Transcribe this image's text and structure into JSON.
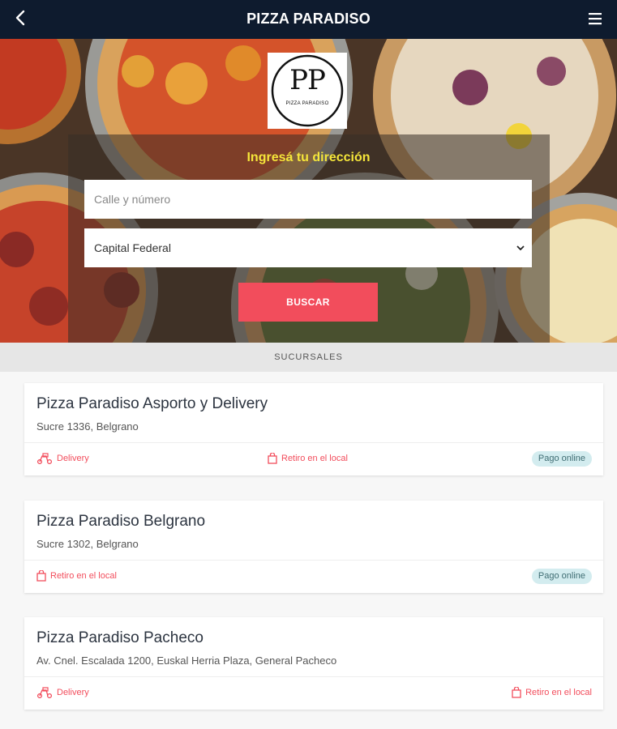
{
  "header": {
    "title": "PIZZA PARADISO"
  },
  "logo": {
    "initials": "PP",
    "subtitle": "PIZZA PARADISO"
  },
  "search": {
    "heading": "Ingresá tu dirección",
    "address_placeholder": "Calle y número",
    "city_selected": "Capital Federal",
    "button_label": "BUSCAR"
  },
  "branches_title": "SUCURSALES",
  "branches": [
    {
      "name": "Pizza Paradiso Asporto y Delivery",
      "address": "Sucre 1336, Belgrano",
      "delivery": "Delivery",
      "pickup": "Retiro en el local",
      "online": "Pago online"
    },
    {
      "name": "Pizza Paradiso Belgrano",
      "address": "Sucre 1302, Belgrano",
      "pickup": "Retiro en el local",
      "online": "Pago online"
    },
    {
      "name": "Pizza Paradiso Pacheco",
      "address": "Av. Cnel. Escalada 1200, Euskal Herria Plaza, General Pacheco",
      "delivery": "Delivery",
      "pickup": "Retiro en el local"
    }
  ],
  "colors": {
    "header": "#0e1b2e",
    "accent": "#f24d5c",
    "heading": "#f5e63a",
    "badge": "#d3ecef"
  }
}
